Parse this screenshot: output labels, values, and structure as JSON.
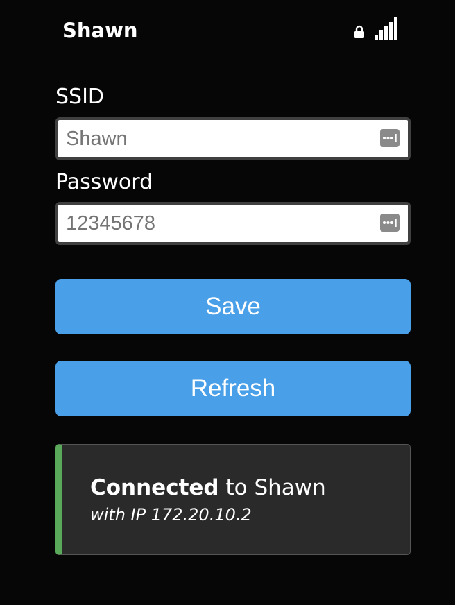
{
  "status_bar": {
    "network_name": "Shawn",
    "lock_icon": "lock-icon",
    "signal_icon": "signal-strength-icon"
  },
  "form": {
    "ssid_label": "SSID",
    "ssid_value": "Shawn",
    "password_label": "Password",
    "password_value": "12345678",
    "autofill_icon": "password-key-icon"
  },
  "buttons": {
    "save_label": "Save",
    "refresh_label": "Refresh"
  },
  "status": {
    "state": "Connected",
    "connected_to": "to Shawn",
    "ip_line": "with IP 172.20.10.2"
  },
  "colors": {
    "background": "#060606",
    "button": "#4aa0e8",
    "status_box": "#2a2a2a",
    "status_accent": "#5aa95a"
  }
}
